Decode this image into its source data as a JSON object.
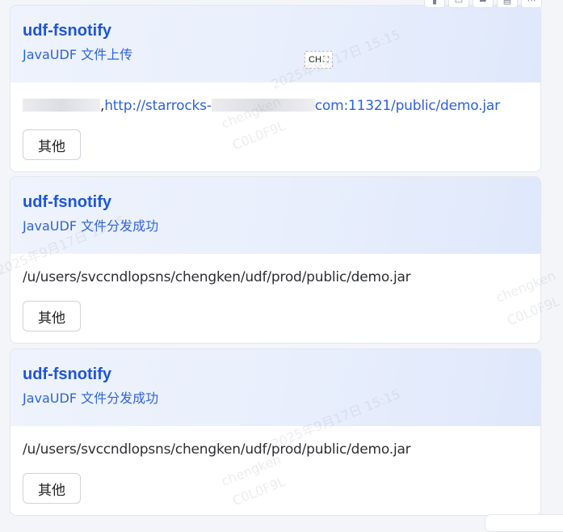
{
  "cards": [
    {
      "title": "udf-fsnotify",
      "subtitle": "JavaUDF 文件上传",
      "body_sep": ",",
      "link_prefix": "http://starrocks-",
      "link_suffix": "com:11321/public/demo.jar",
      "button_label": "其他"
    },
    {
      "title": "udf-fsnotify",
      "subtitle": "JavaUDF 文件分发成功",
      "body": "/u/users/svccndlopsns/chengken/udf/prod/public/demo.jar",
      "button_label": "其他"
    },
    {
      "title": "udf-fsnotify",
      "subtitle": "JavaUDF 文件分发成功",
      "body": "/u/users/svccndlopsns/chengken/udf/prod/public/demo.jar",
      "button_label": "其他"
    }
  ],
  "ime_widget": {
    "label": "CH",
    "expand_glyph": "⛶"
  },
  "toolbar_icons": [
    "copy-icon",
    "comment-icon",
    "share-icon",
    "delete-icon",
    "more-icon"
  ],
  "toolbar_glyphs": [
    "▮",
    "▭",
    "➦",
    "▤",
    "⋯"
  ],
  "watermark": {
    "date": "2025年9月17日 15:15",
    "user": "chengken",
    "code": "C0L0F9L"
  },
  "colors": {
    "title": "#1e56d6",
    "link": "#2c62d6",
    "header_bg": "#e9effc"
  }
}
